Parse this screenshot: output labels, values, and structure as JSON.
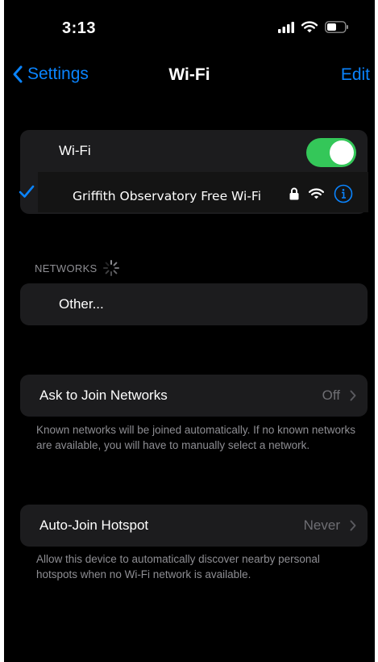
{
  "status_bar": {
    "time": "3:13",
    "icons": [
      "signal-icon",
      "wifi-icon",
      "battery-icon"
    ]
  },
  "nav": {
    "back_label": "Settings",
    "title": "Wi-Fi",
    "edit_label": "Edit"
  },
  "wifi": {
    "label": "Wi-Fi",
    "enabled": true,
    "connected_network": "Griffith Observatory  Free Wi-Fi",
    "connected_icons": [
      "lock-icon",
      "wifi-icon",
      "info-icon"
    ]
  },
  "networks_section": {
    "header": "NETWORKS",
    "items": [
      {
        "label": "Other..."
      }
    ]
  },
  "ask_to_join": {
    "label": "Ask to Join Networks",
    "value": "Off",
    "footer": "Known networks will be joined automatically. If no known networks are available, you will have to manually select a network."
  },
  "auto_join_hotspot": {
    "label": "Auto-Join Hotspot",
    "value": "Never",
    "footer": "Allow this device to automatically discover nearby personal hotspots when no Wi-Fi network is available."
  },
  "colors": {
    "accent": "#0a84ff",
    "toggle_on": "#34c759",
    "background": "#000000",
    "cell": "#1c1c1e",
    "secondary_text": "#8e8e93"
  }
}
